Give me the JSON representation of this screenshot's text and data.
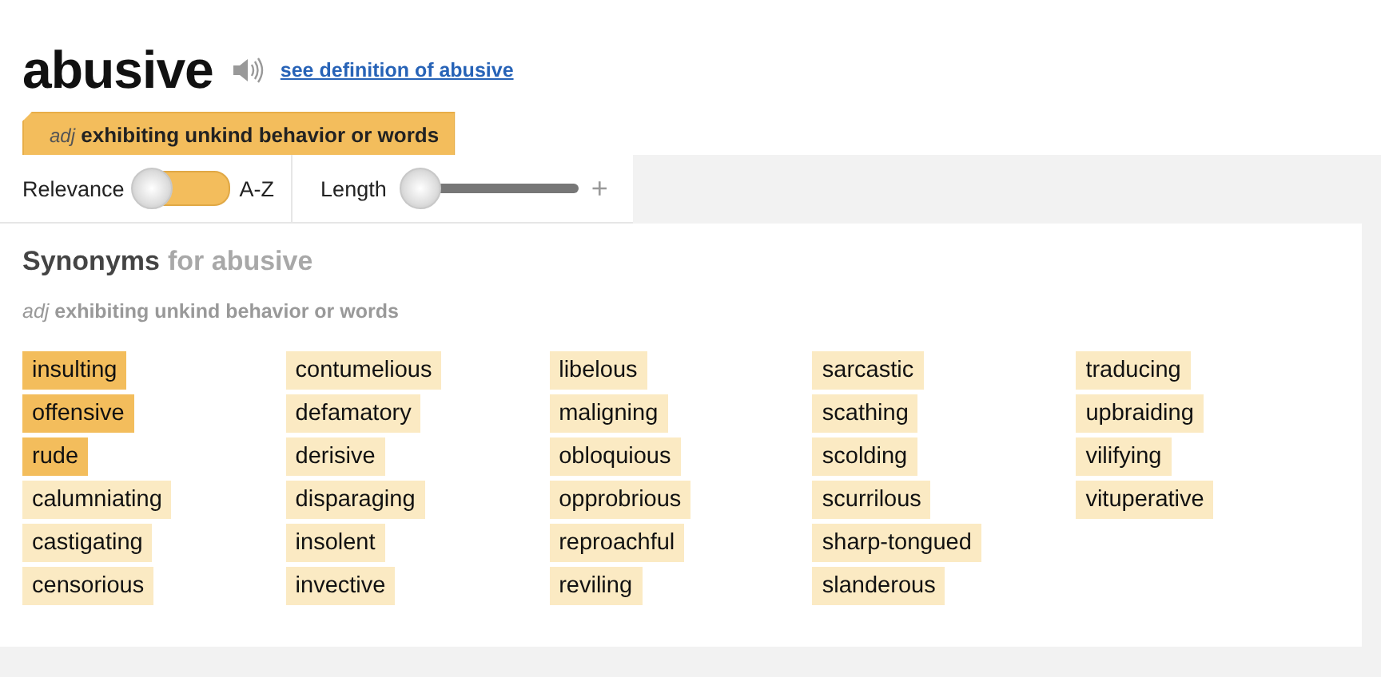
{
  "headword": "abusive",
  "definition_link": "see definition of abusive",
  "sense_tab": {
    "pos": "adj",
    "text": "exhibiting unkind behavior or words"
  },
  "controls": {
    "relevance_label": "Relevance",
    "az_label": "A-Z",
    "az_on": false,
    "length_label": "Length",
    "length_slider": {
      "level": 0
    },
    "plus": "+"
  },
  "synonyms": {
    "title": "Synonyms",
    "subtitle": "for abusive",
    "pos": "adj",
    "sense": "exhibiting unkind behavior or words",
    "columns": [
      [
        {
          "word": "insulting",
          "color": "#f3bd5c"
        },
        {
          "word": "offensive",
          "color": "#f3bd5c"
        },
        {
          "word": "rude",
          "color": "#f3bd5c"
        },
        {
          "word": "calumniating",
          "color": "#fbeac3"
        },
        {
          "word": "castigating",
          "color": "#fbeac3"
        },
        {
          "word": "censorious",
          "color": "#fbeac3"
        }
      ],
      [
        {
          "word": "contumelious",
          "color": "#fbeac3"
        },
        {
          "word": "defamatory",
          "color": "#fbeac3"
        },
        {
          "word": "derisive",
          "color": "#fbeac3"
        },
        {
          "word": "disparaging",
          "color": "#fbeac3"
        },
        {
          "word": "insolent",
          "color": "#fbeac3"
        },
        {
          "word": "invective",
          "color": "#fbeac3"
        }
      ],
      [
        {
          "word": "libelous",
          "color": "#fbeac3"
        },
        {
          "word": "maligning",
          "color": "#fbeac3"
        },
        {
          "word": "obloquious",
          "color": "#fbeac3"
        },
        {
          "word": "opprobrious",
          "color": "#fbeac3"
        },
        {
          "word": "reproachful",
          "color": "#fbeac3"
        },
        {
          "word": "reviling",
          "color": "#fbeac3"
        }
      ],
      [
        {
          "word": "sarcastic",
          "color": "#fbeac3"
        },
        {
          "word": "scathing",
          "color": "#fbeac3"
        },
        {
          "word": "scolding",
          "color": "#fbeac3"
        },
        {
          "word": "scurrilous",
          "color": "#fbeac3"
        },
        {
          "word": "sharp-tongued",
          "color": "#fbeac3"
        },
        {
          "word": "slanderous",
          "color": "#fbeac3"
        }
      ],
      [
        {
          "word": "traducing",
          "color": "#fbeac3"
        },
        {
          "word": "upbraiding",
          "color": "#fbeac3"
        },
        {
          "word": "vilifying",
          "color": "#fbeac3"
        },
        {
          "word": "vituperative",
          "color": "#fbeac3"
        }
      ]
    ]
  }
}
